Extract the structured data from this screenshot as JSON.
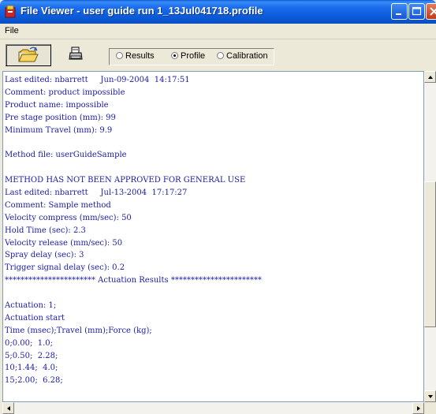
{
  "window": {
    "title": "File Viewer - user guide run 1_13Jul041718.profile"
  },
  "menu": {
    "file": "File"
  },
  "toolbar": {
    "open_icon": "open-folder-icon",
    "print_icon": "printer-icon",
    "view_options": [
      {
        "label": "Results",
        "selected": false
      },
      {
        "label": "Profile",
        "selected": true
      },
      {
        "label": "Calibration",
        "selected": false
      }
    ]
  },
  "content": {
    "lines": [
      "Last edited: nbarrett     Jun-09-2004  14:17:51",
      "Comment: product impossible",
      "Product name: impossible",
      "Pre stage position (mm): 99",
      "Minimum Travel (mm): 9.9",
      "",
      "Method file: userGuideSample",
      "",
      "METHOD HAS NOT BEEN APPROVED FOR GENERAL USE",
      "Last edited: nbarrett     Jul-13-2004  17:17:27",
      "Comment: Sample method",
      "Velocity compress (mm/sec): 50",
      "Hold Time (sec): 2.3",
      "Velocity release (mm/sec): 50",
      "Spray delay (sec): 3",
      "Trigger signal delay (sec): 0.2",
      "*********************** Actuation Results ***********************",
      "",
      "Actuation: 1;",
      "Actuation start",
      "Time (msec);Travel (mm);Force (kg);",
      "0;0.00;  1.0;",
      "5;0.50;  2.28;",
      "10;1.44;  4.0;",
      "15;2.00;  6.28;"
    ]
  },
  "colors": {
    "text": "#1a1aa8",
    "titlebar": "#0b5bd9",
    "close_button": "#c23a18"
  }
}
